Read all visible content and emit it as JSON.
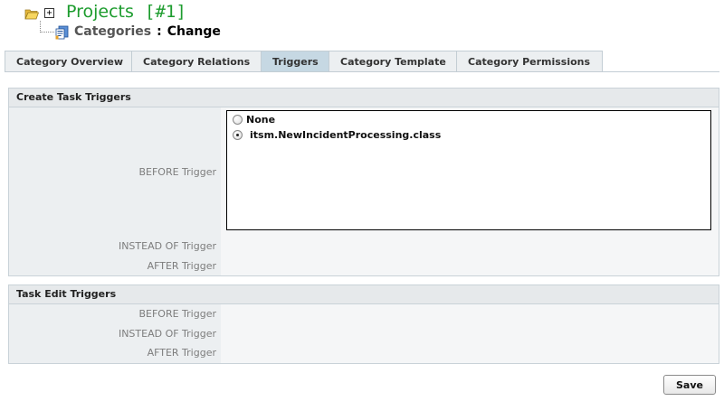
{
  "header": {
    "project_name": "Projects",
    "project_id": "[#1]",
    "breadcrumb_parent": "Categories",
    "breadcrumb_separator": ":",
    "breadcrumb_current": "Change",
    "expander_symbol": "+"
  },
  "tabs": [
    {
      "label": "Category Overview",
      "active": false
    },
    {
      "label": "Category Relations",
      "active": false
    },
    {
      "label": "Triggers",
      "active": true
    },
    {
      "label": "Category Template",
      "active": false
    },
    {
      "label": "Category Permissions",
      "active": false
    }
  ],
  "create_task": {
    "title": "Create Task Triggers",
    "before_label": "BEFORE Trigger",
    "instead_label": "INSTEAD OF Trigger",
    "after_label": "AFTER Trigger",
    "options": [
      {
        "label": "None",
        "selected": false
      },
      {
        "label": "itsm.NewIncidentProcessing.class",
        "selected": true
      }
    ]
  },
  "task_edit": {
    "title": "Task Edit Triggers",
    "before_label": "BEFORE Trigger",
    "instead_label": "INSTEAD OF Trigger",
    "after_label": "AFTER Trigger"
  },
  "actions": {
    "save_label": "Save"
  },
  "colors": {
    "project_title": "#1d9c2e",
    "active_tab": "#c6d8e3",
    "inactive_tab": "#eceff1",
    "section_header": "#e6e9eb"
  }
}
